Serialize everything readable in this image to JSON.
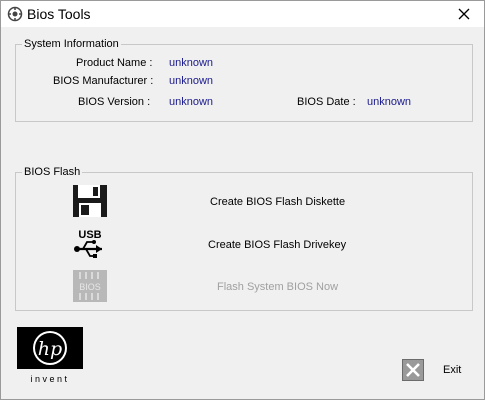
{
  "window": {
    "title": "Bios Tools"
  },
  "system_info": {
    "legend": "System Information",
    "product_name_label": "Product Name :",
    "product_name_value": "unknown",
    "manufacturer_label": "BIOS Manufacturer :",
    "manufacturer_value": "unknown",
    "version_label": "BIOS Version :",
    "version_value": "unknown",
    "date_label": "BIOS Date :",
    "date_value": "unknown"
  },
  "bios_flash": {
    "legend": "BIOS Flash",
    "items": [
      {
        "label": "Create BIOS Flash Diskette",
        "icon": "floppy-disk-icon",
        "enabled": true
      },
      {
        "label": "Create BIOS Flash Drivekey",
        "icon": "usb-icon",
        "enabled": true
      },
      {
        "label": "Flash System BIOS Now",
        "icon": "bios-chip-icon",
        "enabled": false
      }
    ],
    "usb_icon_text": "USB",
    "chip_icon_text": "BIOS"
  },
  "logo": {
    "brand": "hp",
    "tagline": "invent"
  },
  "footer": {
    "exit_label": "Exit"
  },
  "colors": {
    "value_text": "#1a1a8c",
    "disabled_text": "#a0a0a0",
    "window_bg": "#f0f0f0",
    "exit_red": "#d8d8d8"
  }
}
